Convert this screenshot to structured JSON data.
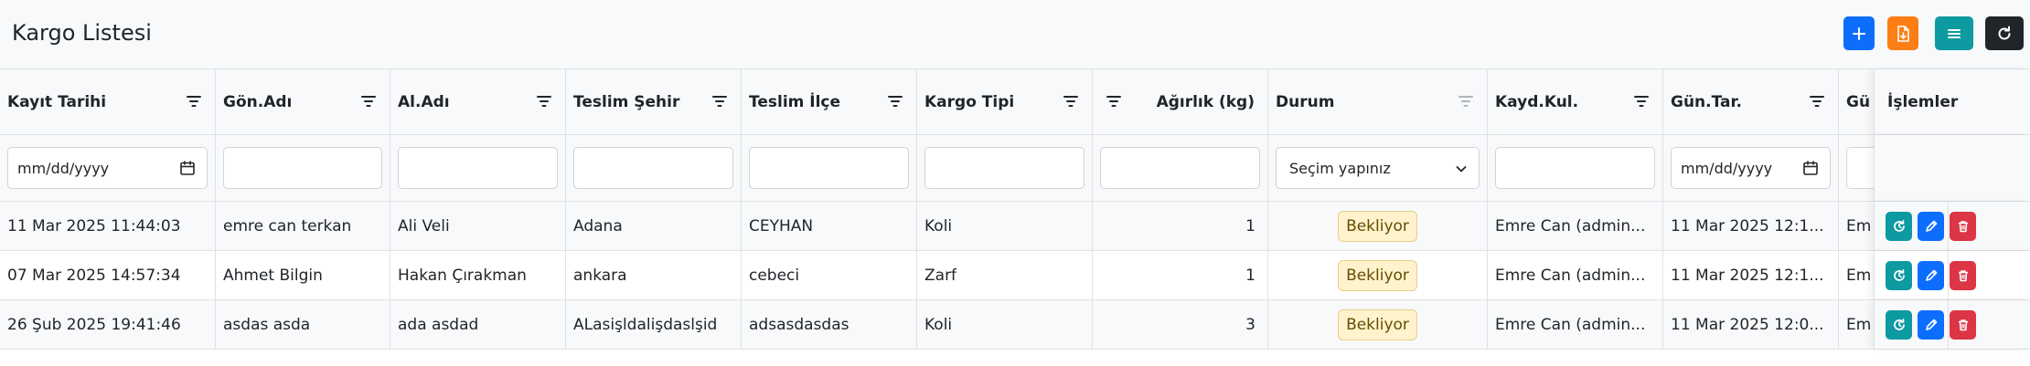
{
  "header": {
    "title": "Kargo Listesi",
    "buttons": [
      {
        "icon": "plus-icon",
        "color": "#0d6efd"
      },
      {
        "icon": "file-export-icon",
        "color": "#fd7e14"
      },
      {
        "icon": "menu-icon",
        "color": "#0d9aa0"
      },
      {
        "icon": "refresh-icon",
        "color": "#212529"
      }
    ]
  },
  "columns": [
    {
      "key": "kayit_tarihi",
      "label": "Kayıt Tarihi",
      "filter": "date",
      "filter_placeholder": "mm/dd/yyyy"
    },
    {
      "key": "gon_adi",
      "label": "Gön.Adı",
      "filter": "text"
    },
    {
      "key": "al_adi",
      "label": "Al.Adı",
      "filter": "text"
    },
    {
      "key": "teslim_sehir",
      "label": "Teslim Şehir",
      "filter": "text"
    },
    {
      "key": "teslim_ilce",
      "label": "Teslim İlçe",
      "filter": "text"
    },
    {
      "key": "kargo_tipi",
      "label": "Kargo Tipi",
      "filter": "text"
    },
    {
      "key": "agirlik",
      "label": "Ağırlık (kg)",
      "filter": "text",
      "align": "right"
    },
    {
      "key": "durum",
      "label": "Durum",
      "filter": "select",
      "filter_value": "Seçim yapınız"
    },
    {
      "key": "kayd_kul",
      "label": "Kayd.Kul.",
      "filter": "text"
    },
    {
      "key": "gun_tar",
      "label": "Gün.Tar.",
      "filter": "date",
      "filter_placeholder": "mm/dd/yyyy"
    },
    {
      "key": "gun_kul",
      "label": "Gü",
      "filter": "text"
    }
  ],
  "actions_label": "İşlemler",
  "rows": [
    {
      "kayit_tarihi": "11 Mar 2025 11:44:03",
      "gon_adi": "emre can terkan",
      "al_adi": "Ali Veli",
      "teslim_sehir": "Adana",
      "teslim_ilce": "CEYHAN",
      "kargo_tipi": "Koli",
      "agirlik": "1",
      "durum": "Bekliyor",
      "kayd_kul": "Emre Can (admin...",
      "gun_tar": "11 Mar 2025 12:1...",
      "gun_kul": "Em"
    },
    {
      "kayit_tarihi": "07 Mar 2025 14:57:34",
      "gon_adi": "Ahmet Bilgin",
      "al_adi": "Hakan Çırakman",
      "teslim_sehir": "ankara",
      "teslim_ilce": "cebeci",
      "kargo_tipi": "Zarf",
      "agirlik": "1",
      "durum": "Bekliyor",
      "kayd_kul": "Emre Can (admin...",
      "gun_tar": "11 Mar 2025 12:1...",
      "gun_kul": "Em"
    },
    {
      "kayit_tarihi": "26 Şub 2025 19:41:46",
      "gon_adi": "asdas asda",
      "al_adi": "ada asdad",
      "teslim_sehir": "ALasişldalişdaslşid",
      "teslim_ilce": "adsasdasdas",
      "kargo_tipi": "Koli",
      "agirlik": "3",
      "durum": "Bekliyor",
      "kayd_kul": "Emre Can (admin...",
      "gun_tar": "11 Mar 2025 12:0...",
      "gun_kul": "Em"
    }
  ]
}
